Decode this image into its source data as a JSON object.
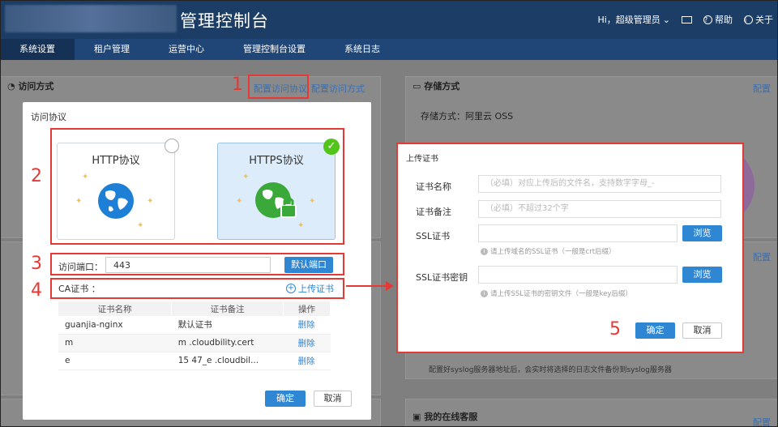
{
  "header": {
    "title": "管理控制台",
    "user": "Hi，超级管理员",
    "help": "帮助",
    "about": "关于"
  },
  "nav": [
    "系统设置",
    "租户管理",
    "运营中心",
    "管理控制台设置",
    "系统日志"
  ],
  "background": {
    "access_panel_title": "访问方式",
    "config_protocol_link": "配置访问协议",
    "config_method_link": "配置访问方式",
    "storage_panel_title": "存储方式",
    "storage_config_link": "配置",
    "storage_type": "存储方式：阿里云 OSS",
    "side_config_link": "配置",
    "syslog_text": "配置好syslog服务器地址后，会实时将选择的日志文件备份到syslog服务器",
    "online_service_title": "我的在线客服",
    "bottom_config_link": "配置"
  },
  "dialog": {
    "title": "访问协议",
    "http_label": "HTTP协议",
    "https_label": "HTTPS协议",
    "port_label": "访问端口：",
    "port_value": "443",
    "default_port_button": "默认端口",
    "ca_label": "CA证书 ：",
    "upload_link": "上传证书",
    "table_headers": [
      "证书名称",
      "证书备注",
      "操作"
    ],
    "table_rows": [
      {
        "name": "guanjia-nginx",
        "note": "默认证书",
        "action": "删除"
      },
      {
        "name": "m",
        "note": "m .cloudbility.cert",
        "action": "删除"
      },
      {
        "name": "e",
        "note": "15 47_e .cloudbil...",
        "action": "删除"
      }
    ],
    "ok_button": "确定",
    "cancel_button": "取消"
  },
  "upload_dialog": {
    "title": "上传证书",
    "name_label": "证书名称",
    "name_placeholder": "（必填）对应上传后的文件名，支持数字字母_-",
    "note_label": "证书备注",
    "note_placeholder": "（必填）不超过32个字",
    "ssl_cert_label": "SSL证书",
    "ssl_cert_hint": "请上传域名的SSL证书（一般是crt后缀）",
    "ssl_key_label": "SSL证书密钥",
    "ssl_key_hint": "请上传SSL证书的密钥文件（一般是key后缀）",
    "browse_button": "浏览",
    "ok_button": "确定",
    "cancel_button": "取消"
  },
  "annotations": [
    "1",
    "2",
    "3",
    "4",
    "5"
  ],
  "colors": {
    "header": "#1b3d66",
    "nav": "#1f4677",
    "primary": "#2f86d3",
    "annotation": "#e53935",
    "check": "#52c41a"
  }
}
